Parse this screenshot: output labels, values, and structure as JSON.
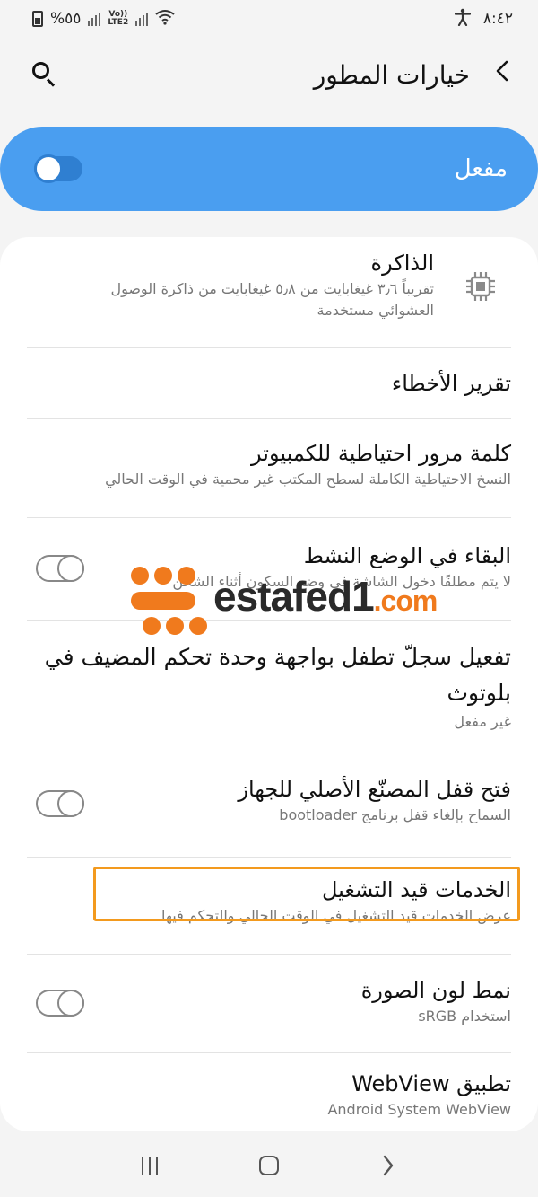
{
  "status_bar": {
    "time": "٨:٤٢",
    "battery_percent": "%٥٥",
    "lte_label_top": "Vo))",
    "lte_label_bottom": "LTE2",
    "accessibility_icon": "accessibility-icon",
    "wifi_icon": "wifi-icon"
  },
  "header": {
    "title": "خيارات المطور",
    "back_icon": "chevron-left-icon",
    "search_icon": "search-icon"
  },
  "master_toggle": {
    "label": "مفعل",
    "state": "on"
  },
  "items": [
    {
      "title": "الذاكرة",
      "subtitle": "تقريباً ٣٫٦ غيغابايت من ٥٫٨ غيغابايت من ذاكرة الوصول العشوائي مستخدمة",
      "icon": "memory-chip-icon"
    },
    {
      "title": "تقرير الأخطاء"
    },
    {
      "title": "كلمة مرور احتياطية للكمبيوتر",
      "subtitle": "النسخ الاحتياطية الكاملة لسطح المكتب غير محمية في الوقت الحالي"
    },
    {
      "title": "البقاء في الوضع النشط",
      "subtitle": "لا يتم مطلقًا دخول الشاشة في وضع السكون أثناء الشحن",
      "toggle": "off"
    },
    {
      "title": "تفعيل سجلّ تطفل بواجهة وحدة تحكم المضيف في بلوتوث",
      "subtitle": "غير مفعل"
    },
    {
      "title": "فتح قفل المصنّع الأصلي للجهاز",
      "subtitle": "السماح بإلغاء قفل برنامج bootloader",
      "toggle": "off"
    },
    {
      "title": "الخدمات قيد التشغيل",
      "subtitle": "عرض الخدمات قيد التشغيل في الوقت الحالي والتحكم فيها",
      "highlighted": true
    },
    {
      "title": "نمط لون الصورة",
      "subtitle": "استخدام sRGB",
      "toggle": "off"
    },
    {
      "title": "تطبيق WebView",
      "subtitle": "Android System WebView"
    }
  ],
  "watermark": {
    "text": "estafed1",
    "suffix": ".com"
  },
  "colors": {
    "accent": "#4a9ef0",
    "highlight": "#f39a1e",
    "watermark_orange": "#f07a1d"
  }
}
